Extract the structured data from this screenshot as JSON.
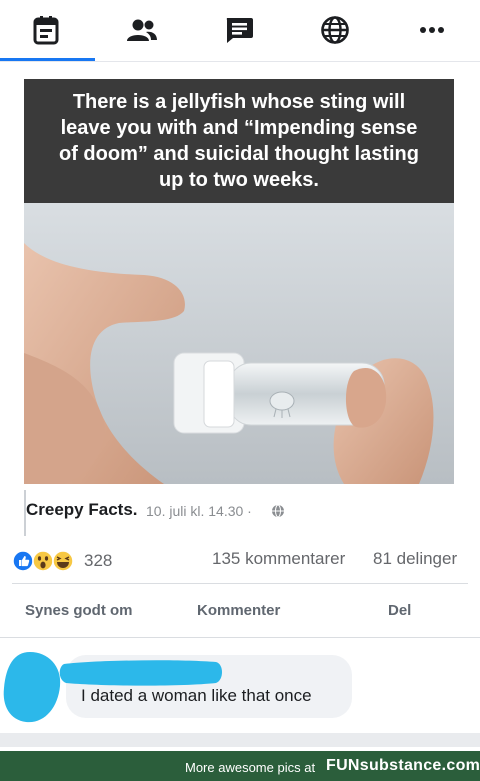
{
  "nav": {
    "tabs": [
      {
        "name": "feed",
        "icon": "newspaper-icon",
        "active": true
      },
      {
        "name": "friends",
        "icon": "people-icon",
        "active": false
      },
      {
        "name": "messages",
        "icon": "chat-icon",
        "active": false
      },
      {
        "name": "explore",
        "icon": "globe-icon",
        "active": false
      },
      {
        "name": "more",
        "icon": "more-icon",
        "active": false
      }
    ],
    "accent_color": "#1877f2"
  },
  "post": {
    "image_caption": "There is a jellyfish whose sting will\nleave you with and “Impending sense\nof doom” and suicidal thought lasting\nup to two weeks.",
    "page_name": "Creepy Facts.",
    "timestamp": "10. juli kl. 14.30 ·",
    "reaction_count": "328",
    "comments": "135 kommentarer",
    "shares": "81 delinger"
  },
  "actions": {
    "like": "Synes godt om",
    "comment": "Kommenter",
    "share": "Del"
  },
  "comment": {
    "text": "I dated a woman like that once"
  },
  "banner": {
    "text": "More awesome pics at",
    "logo": "FUNsubstance.com"
  }
}
